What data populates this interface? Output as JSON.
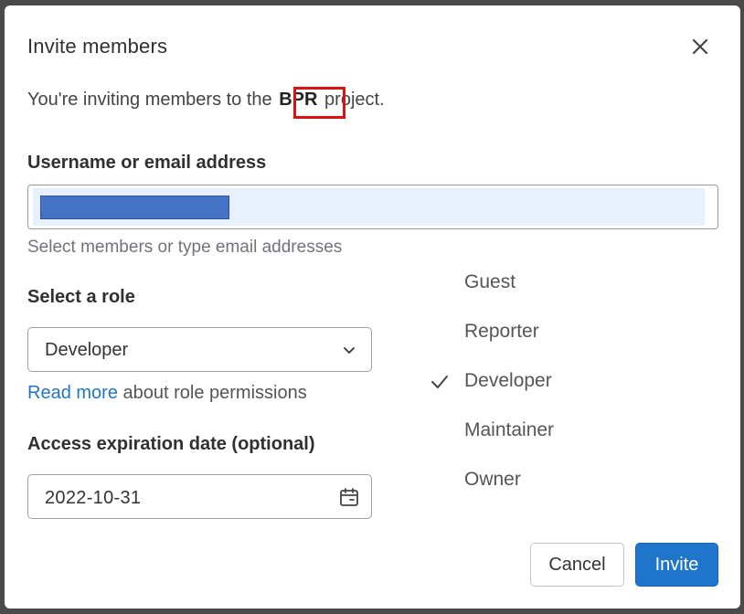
{
  "modal": {
    "title": "Invite members",
    "close_icon": "close-icon"
  },
  "intro": {
    "prefix": "You're inviting members to the",
    "project_name": "BPR",
    "suffix": "project."
  },
  "username": {
    "label": "Username or email address",
    "helper": "Select members or type email addresses"
  },
  "role": {
    "label": "Select a role",
    "selected": "Developer",
    "chevron_icon": "chevron-down-icon",
    "read_more_link": "Read more",
    "read_more_suffix": "about role permissions",
    "options": [
      "Guest",
      "Reporter",
      "Developer",
      "Maintainer",
      "Owner"
    ]
  },
  "expiration": {
    "label": "Access expiration date (optional)",
    "value": "2022-10-31",
    "calendar_icon": "calendar-icon"
  },
  "actions": {
    "cancel_label": "Cancel",
    "invite_label": "Invite"
  },
  "colors": {
    "primary": "#1f75cb",
    "highlight": "#e01010",
    "redaction": "#4472c4"
  }
}
